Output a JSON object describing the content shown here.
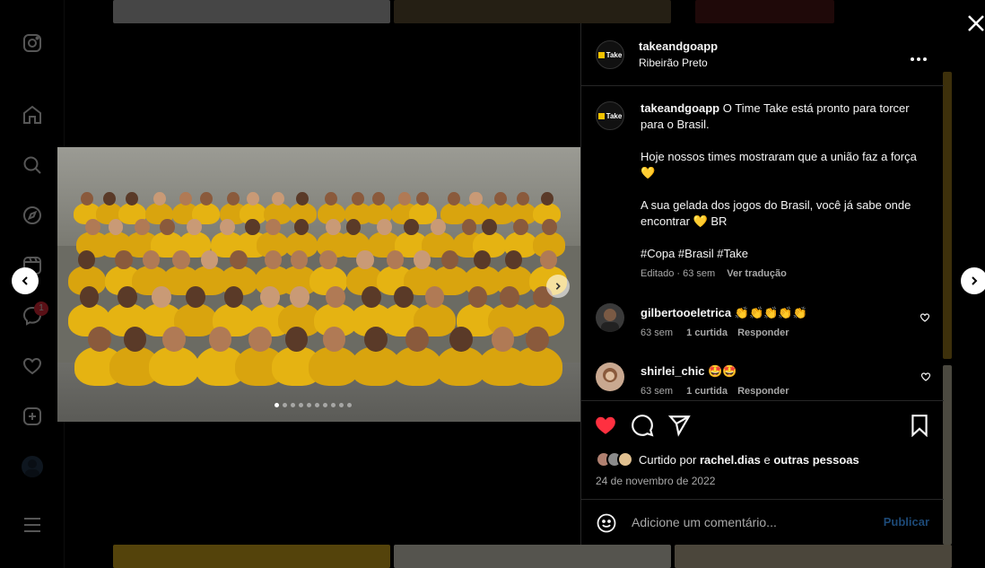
{
  "post": {
    "username": "takeandgoapp",
    "location": "Ribeirão Preto",
    "logo_text": "Take",
    "caption_user": "takeandgoapp",
    "caption_lines": [
      "O Time Take está pronto para torcer para o Brasil.",
      "Hoje nossos times mostraram que a união faz a força 💛",
      "A sua gelada dos jogos do Brasil, você já sabe onde encontrar 💛 BR",
      "#Copa #Brasil #Take"
    ],
    "caption_meta": "Editado · 63 sem",
    "translate_label": "Ver tradução",
    "liked_by_prefix": "Curtido por",
    "liked_by_user": "rachel.dias",
    "liked_by_suffix": "e",
    "liked_by_others": "outras pessoas",
    "date": "24 de novembro de 2022",
    "carousel_count": 10,
    "carousel_active": 0
  },
  "comments": [
    {
      "user": "gilbertooeletrica",
      "text": "👏👏👏👏👏",
      "time": "63 sem",
      "likes": "1 curtida",
      "reply": "Responder"
    },
    {
      "user": "shirlei_chic",
      "text": "🤩🤩",
      "time": "63 sem",
      "likes": "1 curtida",
      "reply": "Responder"
    }
  ],
  "composer": {
    "placeholder": "Adicione um comentário...",
    "post_label": "Publicar"
  },
  "sidebar": {
    "notification_count": "1"
  },
  "colors": {
    "like_red": "#ff3040",
    "accent_yellow": "#f2c200",
    "background": "#000000"
  }
}
